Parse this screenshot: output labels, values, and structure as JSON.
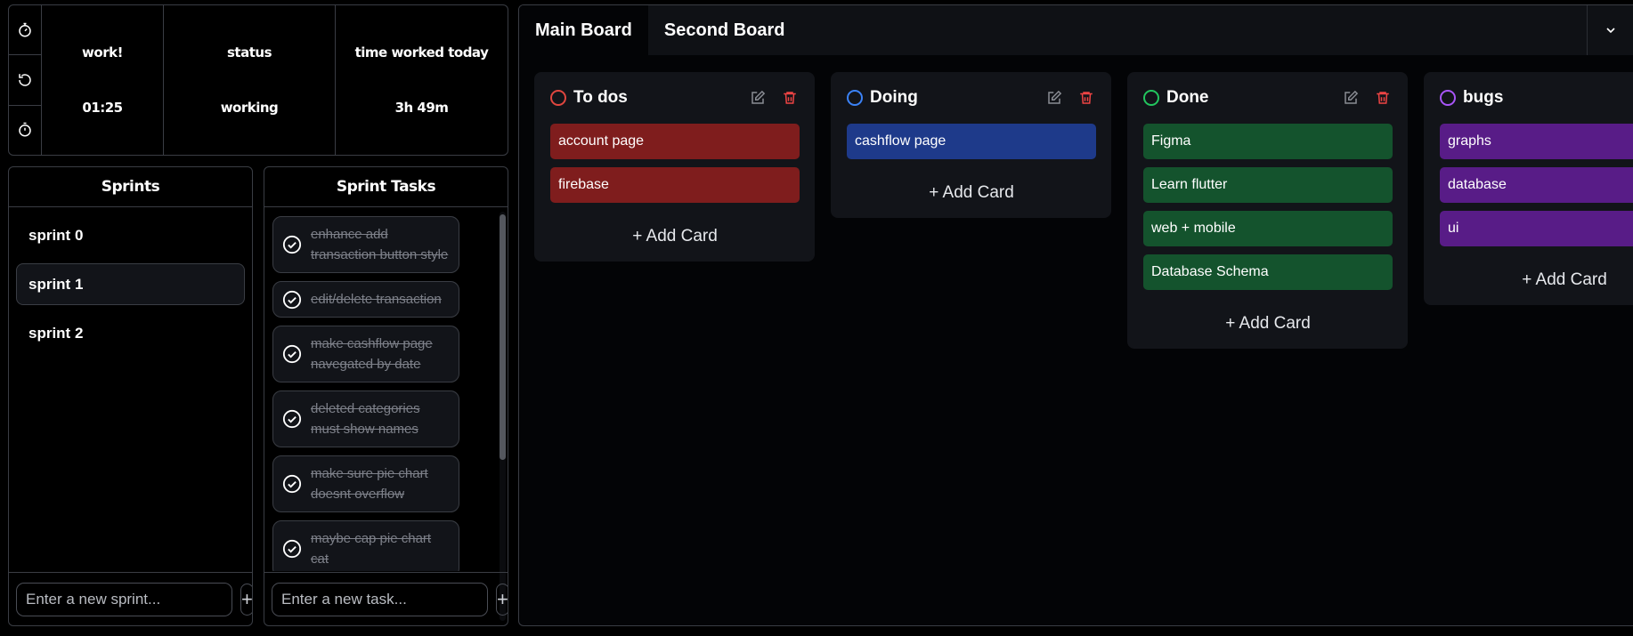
{
  "timer": {
    "work_label": "work!",
    "work_value": "01:25",
    "status_label": "status",
    "status_value": "working",
    "today_label": "time worked today",
    "today_value": "3h 49m",
    "icons": [
      "stopwatch-icon",
      "reset-icon",
      "timer-icon"
    ]
  },
  "sprints": {
    "title": "Sprints",
    "items": [
      {
        "label": "sprint 0",
        "active": false
      },
      {
        "label": "sprint 1",
        "active": true
      },
      {
        "label": "sprint 2",
        "active": false
      }
    ],
    "input_placeholder": "Enter a new sprint..."
  },
  "tasks": {
    "title": "Sprint Tasks",
    "items": [
      {
        "label": "enhance add transaction button style",
        "done": true
      },
      {
        "label": "edit/delete transaction",
        "done": true
      },
      {
        "label": "make cashflow page navegated by date",
        "done": true
      },
      {
        "label": "deleted categories must show names",
        "done": true
      },
      {
        "label": "make sure pie chart doesnt overflow",
        "done": true
      },
      {
        "label": "maybe cap pie chart cat",
        "done": true
      }
    ],
    "input_placeholder": "Enter a new task..."
  },
  "board": {
    "tabs": [
      {
        "label": "Main Board",
        "active": true
      },
      {
        "label": "Second Board",
        "active": false
      }
    ],
    "add_card_label": "+ Add Card",
    "columns": [
      {
        "title": "To dos",
        "dot_color": "#e0463f",
        "card_color": "#7f1d1d",
        "cards": [
          "account page",
          "firebase"
        ]
      },
      {
        "title": "Doing",
        "dot_color": "#3b82f6",
        "card_color": "#1e3a8a",
        "cards": [
          "cashflow page"
        ]
      },
      {
        "title": "Done",
        "dot_color": "#22c55e",
        "card_color": "#14532d",
        "cards": [
          "Figma",
          "Learn flutter",
          "web + mobile",
          "Database Schema"
        ]
      },
      {
        "title": "bugs",
        "dot_color": "#a855f7",
        "card_color": "#581c87",
        "cards": [
          "graphs",
          "database",
          "ui"
        ]
      }
    ]
  },
  "colors": {
    "border": "#3a3d44",
    "delete": "#ef4444",
    "edit": "#8a8d94"
  }
}
